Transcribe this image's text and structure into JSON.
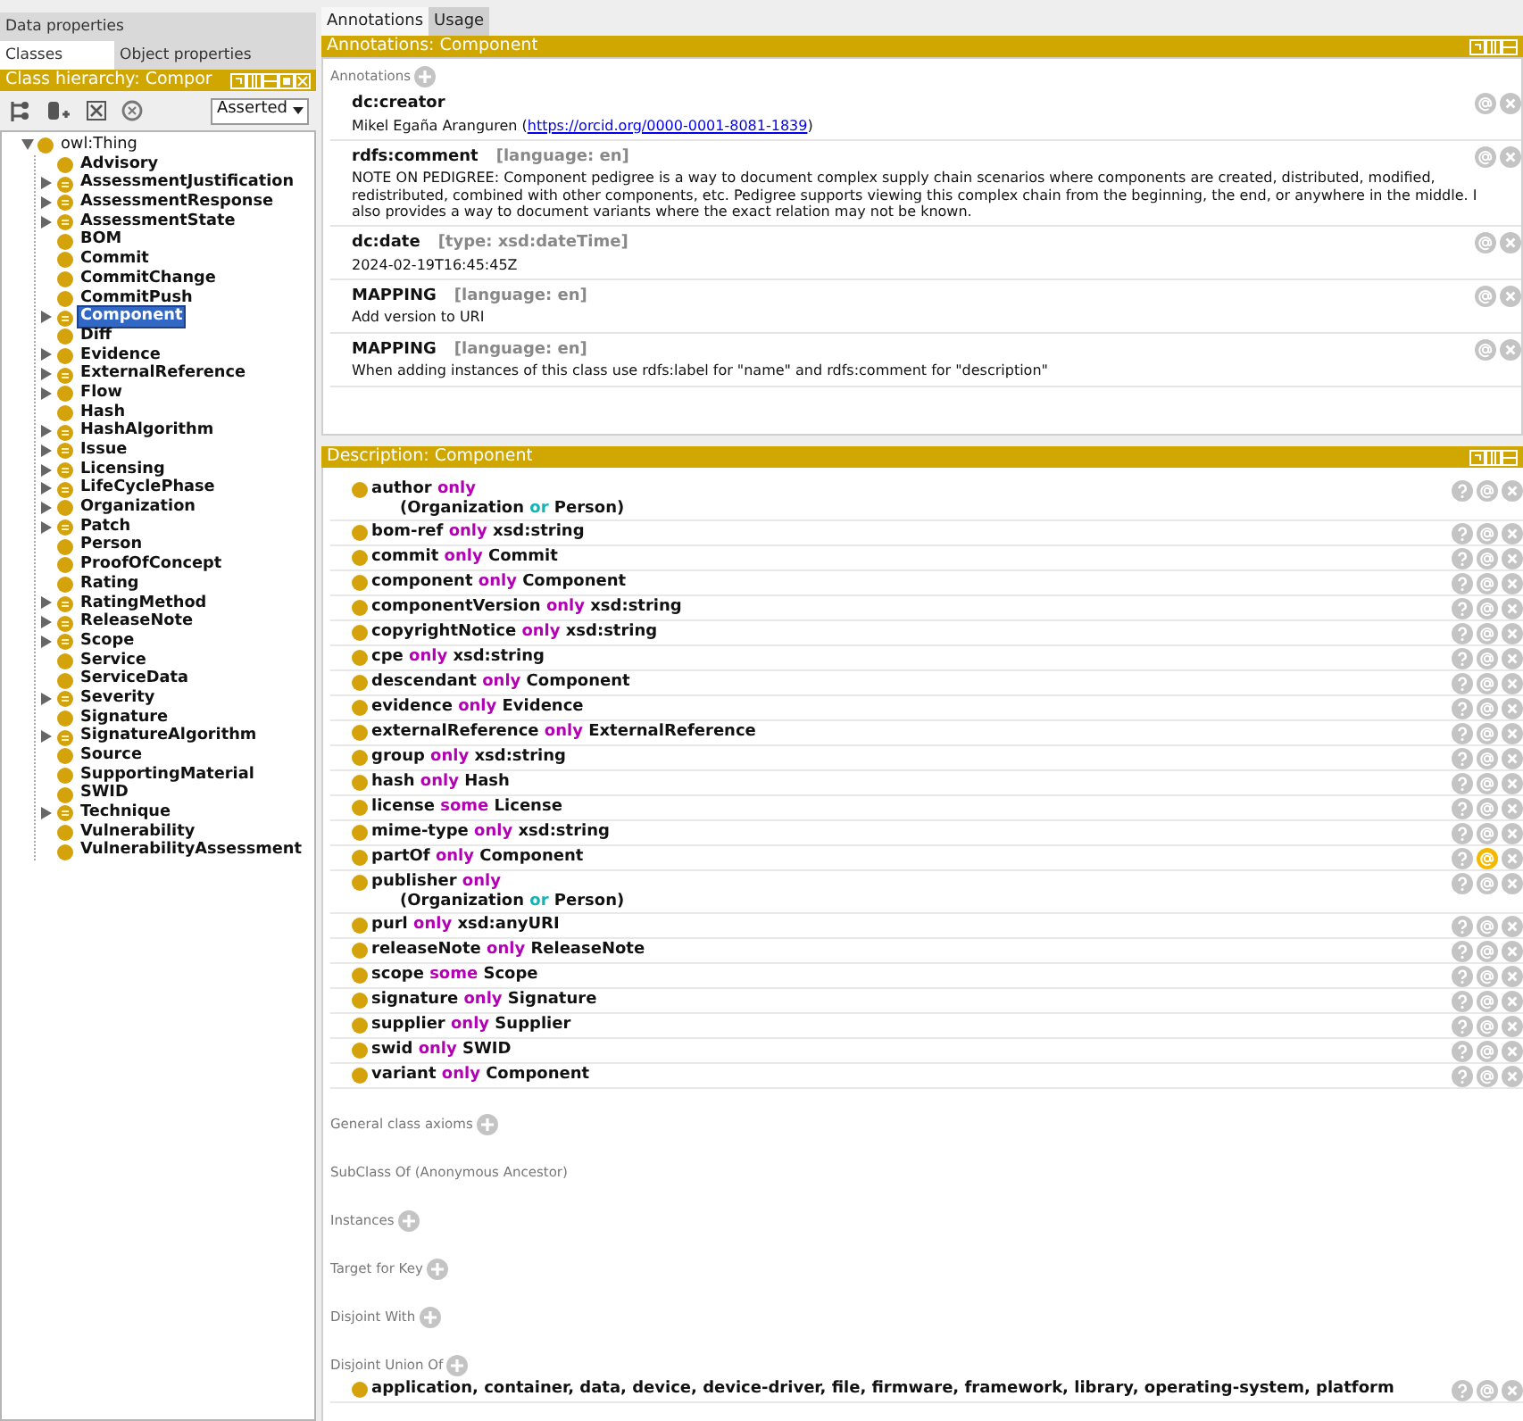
{
  "left": {
    "tab_rows": [
      [
        {
          "label": "Data properties",
          "selected": false
        }
      ],
      [
        {
          "label": "Classes",
          "selected": true
        },
        {
          "label": "Object properties",
          "selected": false
        }
      ]
    ],
    "hierarchy_title": "Class hierarchy: Compor",
    "view_select": "Asserted",
    "tree": [
      {
        "label": "owl:Thing",
        "expandable": true,
        "expanded": true,
        "defined": false,
        "selected": false,
        "children": [
          {
            "label": "Advisory",
            "expandable": false,
            "defined": false,
            "selected": false
          },
          {
            "label": "AssessmentJustification",
            "expandable": true,
            "expanded": false,
            "defined": true,
            "selected": false
          },
          {
            "label": "AssessmentResponse",
            "expandable": true,
            "expanded": false,
            "defined": true,
            "selected": false
          },
          {
            "label": "AssessmentState",
            "expandable": true,
            "expanded": false,
            "defined": true,
            "selected": false
          },
          {
            "label": "BOM",
            "expandable": false,
            "defined": false,
            "selected": false
          },
          {
            "label": "Commit",
            "expandable": false,
            "defined": false,
            "selected": false
          },
          {
            "label": "CommitChange",
            "expandable": false,
            "defined": false,
            "selected": false
          },
          {
            "label": "CommitPush",
            "expandable": false,
            "defined": false,
            "selected": false
          },
          {
            "label": "Component",
            "expandable": true,
            "expanded": false,
            "defined": true,
            "selected": true
          },
          {
            "label": "Diff",
            "expandable": false,
            "defined": false,
            "selected": false
          },
          {
            "label": "Evidence",
            "expandable": true,
            "expanded": false,
            "defined": false,
            "selected": false
          },
          {
            "label": "ExternalReference",
            "expandable": true,
            "expanded": false,
            "defined": true,
            "selected": false
          },
          {
            "label": "Flow",
            "expandable": true,
            "expanded": false,
            "defined": false,
            "selected": false
          },
          {
            "label": "Hash",
            "expandable": false,
            "defined": false,
            "selected": false
          },
          {
            "label": "HashAlgorithm",
            "expandable": true,
            "expanded": false,
            "defined": true,
            "selected": false
          },
          {
            "label": "Issue",
            "expandable": true,
            "expanded": false,
            "defined": true,
            "selected": false
          },
          {
            "label": "Licensing",
            "expandable": true,
            "expanded": false,
            "defined": true,
            "selected": false
          },
          {
            "label": "LifeCyclePhase",
            "expandable": true,
            "expanded": false,
            "defined": true,
            "selected": false
          },
          {
            "label": "Organization",
            "expandable": true,
            "expanded": false,
            "defined": false,
            "selected": false
          },
          {
            "label": "Patch",
            "expandable": true,
            "expanded": false,
            "defined": true,
            "selected": false
          },
          {
            "label": "Person",
            "expandable": false,
            "defined": false,
            "selected": false
          },
          {
            "label": "ProofOfConcept",
            "expandable": false,
            "defined": false,
            "selected": false
          },
          {
            "label": "Rating",
            "expandable": false,
            "defined": false,
            "selected": false
          },
          {
            "label": "RatingMethod",
            "expandable": true,
            "expanded": false,
            "defined": true,
            "selected": false
          },
          {
            "label": "ReleaseNote",
            "expandable": true,
            "expanded": false,
            "defined": true,
            "selected": false
          },
          {
            "label": "Scope",
            "expandable": true,
            "expanded": false,
            "defined": true,
            "selected": false
          },
          {
            "label": "Service",
            "expandable": false,
            "defined": false,
            "selected": false
          },
          {
            "label": "ServiceData",
            "expandable": false,
            "defined": false,
            "selected": false
          },
          {
            "label": "Severity",
            "expandable": true,
            "expanded": false,
            "defined": true,
            "selected": false
          },
          {
            "label": "Signature",
            "expandable": false,
            "defined": false,
            "selected": false
          },
          {
            "label": "SignatureAlgorithm",
            "expandable": true,
            "expanded": false,
            "defined": true,
            "selected": false
          },
          {
            "label": "Source",
            "expandable": false,
            "defined": false,
            "selected": false
          },
          {
            "label": "SupportingMaterial",
            "expandable": false,
            "defined": false,
            "selected": false
          },
          {
            "label": "SWID",
            "expandable": false,
            "defined": false,
            "selected": false
          },
          {
            "label": "Technique",
            "expandable": true,
            "expanded": false,
            "defined": true,
            "selected": false
          },
          {
            "label": "Vulnerability",
            "expandable": false,
            "defined": false,
            "selected": false
          },
          {
            "label": "VulnerabilityAssessment",
            "expandable": false,
            "defined": false,
            "selected": false
          }
        ]
      }
    ]
  },
  "right": {
    "tabs": [
      {
        "label": "Annotations",
        "selected": true
      },
      {
        "label": "Usage",
        "selected": false
      }
    ],
    "annotations_title": "Annotations: Component",
    "annotations_heading": "Annotations",
    "annotations": [
      {
        "property": "dc:creator",
        "text_before": "Mikel Egaña Aranguren (",
        "link": "https://orcid.org/0000-0001-8081-1839",
        "text_after": ")"
      },
      {
        "property": "rdfs:comment",
        "qualifier": "[language: en]",
        "lines": [
          "NOTE ON PEDIGREE: Component pedigree is a way to document complex supply chain scenarios where components are created, distributed, modified,",
          "redistributed, combined with other components, etc. Pedigree supports viewing this complex chain from the beginning, the end, or anywhere in the middle. I",
          "also provides a way to document variants where the exact relation may not be known."
        ]
      },
      {
        "property": "dc:date",
        "qualifier": "[type: xsd:dateTime]",
        "lines": [
          "2024-02-19T16:45:45Z"
        ]
      },
      {
        "property": "MAPPING",
        "qualifier": "[language: en]",
        "lines": [
          "Add version to URI"
        ]
      },
      {
        "property": "MAPPING",
        "qualifier": "[language: en]",
        "lines": [
          "When adding instances of this class use rdfs:label for \"name\" and rdfs:comment for \"description\""
        ]
      }
    ],
    "description_title": "Description: Component",
    "rows": [
      {
        "kind": "union",
        "property": "author",
        "quantifier": "only",
        "left": "(Organization",
        "op": "or",
        "right": "Person)",
        "hover": false
      },
      {
        "kind": "restriction",
        "property": "bom-ref",
        "quantifier": "only",
        "filler": "xsd:string",
        "hover": false
      },
      {
        "kind": "restriction",
        "property": "commit",
        "quantifier": "only",
        "filler": "Commit",
        "hover": false
      },
      {
        "kind": "restriction",
        "property": "component",
        "quantifier": "only",
        "filler": "Component",
        "hover": false
      },
      {
        "kind": "restriction",
        "property": "componentVersion",
        "quantifier": "only",
        "filler": "xsd:string",
        "hover": false
      },
      {
        "kind": "restriction",
        "property": "copyrightNotice",
        "quantifier": "only",
        "filler": "xsd:string",
        "hover": false
      },
      {
        "kind": "restriction",
        "property": "cpe",
        "quantifier": "only",
        "filler": "xsd:string",
        "hover": false
      },
      {
        "kind": "restriction",
        "property": "descendant",
        "quantifier": "only",
        "filler": "Component",
        "hover": false
      },
      {
        "kind": "restriction",
        "property": "evidence",
        "quantifier": "only",
        "filler": "Evidence",
        "hover": false
      },
      {
        "kind": "restriction",
        "property": "externalReference",
        "quantifier": "only",
        "filler": "ExternalReference",
        "hover": false
      },
      {
        "kind": "restriction",
        "property": "group",
        "quantifier": "only",
        "filler": "xsd:string",
        "hover": false
      },
      {
        "kind": "restriction",
        "property": "hash",
        "quantifier": "only",
        "filler": "Hash",
        "hover": false
      },
      {
        "kind": "restriction",
        "property": "license",
        "quantifier": "some",
        "filler": "License",
        "hover": false
      },
      {
        "kind": "restriction",
        "property": "mime-type",
        "quantifier": "only",
        "filler": "xsd:string",
        "hover": false
      },
      {
        "kind": "restriction",
        "property": "partOf",
        "quantifier": "only",
        "filler": "Component",
        "hover": true
      },
      {
        "kind": "union",
        "property": "publisher",
        "quantifier": "only",
        "left": "(Organization",
        "op": "or",
        "right": "Person)",
        "hover": false
      },
      {
        "kind": "restriction",
        "property": "purl",
        "quantifier": "only",
        "filler": "xsd:anyURI",
        "hover": false
      },
      {
        "kind": "restriction",
        "property": "releaseNote",
        "quantifier": "only",
        "filler": "ReleaseNote",
        "hover": false
      },
      {
        "kind": "restriction",
        "property": "scope",
        "quantifier": "some",
        "filler": "Scope",
        "hover": false
      },
      {
        "kind": "restriction",
        "property": "signature",
        "quantifier": "only",
        "filler": "Signature",
        "hover": false
      },
      {
        "kind": "restriction",
        "property": "supplier",
        "quantifier": "only",
        "filler": "Supplier",
        "hover": false
      },
      {
        "kind": "restriction",
        "property": "swid",
        "quantifier": "only",
        "filler": "SWID",
        "hover": false
      },
      {
        "kind": "restriction",
        "property": "variant",
        "quantifier": "only",
        "filler": "Component",
        "hover": false
      }
    ],
    "sections": [
      {
        "title": "General class axioms",
        "addable": true
      },
      {
        "title": "SubClass Of (Anonymous Ancestor)",
        "addable": false
      },
      {
        "title": "Instances",
        "addable": true
      },
      {
        "title": "Target for Key",
        "addable": true
      },
      {
        "title": "Disjoint With",
        "addable": true
      },
      {
        "title": "Disjoint Union Of",
        "addable": true,
        "rows": [
          {
            "kind": "list",
            "filler": "application, container, data, device, device-driver, file, firmware, framework, library, operating-system, platform",
            "hover": false
          }
        ]
      }
    ]
  }
}
